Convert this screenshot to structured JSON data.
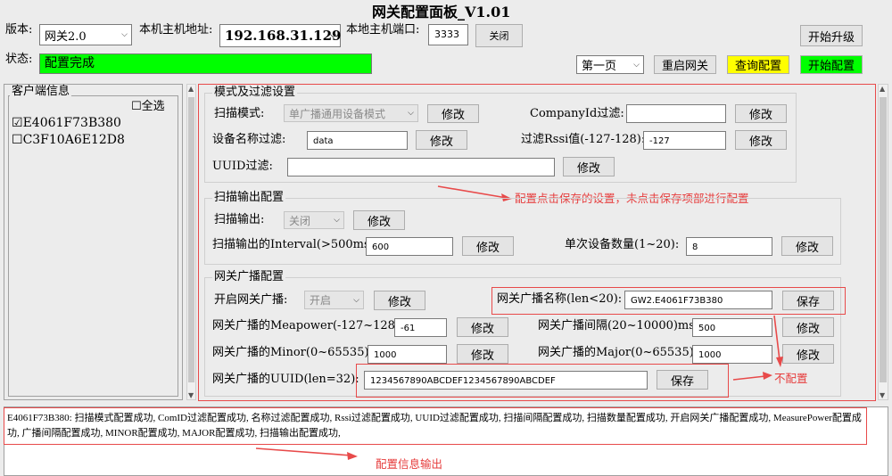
{
  "title": "网关配置面板_V1.01",
  "version": {
    "label": "版本:",
    "value": "网关2.0"
  },
  "host": {
    "label": "本机主机地址:",
    "value": "192.168.31.129"
  },
  "port": {
    "label": "本地主机端口:",
    "value": "3333",
    "close_label": "关闭"
  },
  "upgrade_label": "开始升级",
  "status": {
    "label": "状态:",
    "value": "配置完成",
    "color": "#00ff00"
  },
  "page_select": "第一页",
  "restart_label": "重启网关",
  "query_label": "查询配置",
  "start_label": "开始配置",
  "client": {
    "title": "客户端信息",
    "select_all": "全选",
    "items": [
      "E4061F73B380",
      "C3F10A6E12D8"
    ],
    "checked": [
      true,
      false
    ]
  },
  "mode": {
    "title": "模式及过滤设置",
    "scan_mode_label": "扫描模式:",
    "scan_mode_value": "单广播通用设备模式",
    "company_label": "CompanyId过滤:",
    "company_value": "",
    "name_label": "设备名称过滤:",
    "name_value": "data",
    "rssi_label": "过滤Rssi值(-127-128):",
    "rssi_value": "-127",
    "uuid_label": "UUID过滤:",
    "uuid_value": ""
  },
  "scan_out": {
    "title": "扫描输出配置",
    "output_label": "扫描输出:",
    "output_value": "关闭",
    "interval_label": "扫描输出的Interval(>500ms):",
    "interval_value": "600",
    "count_label": "单次设备数量(1~20):",
    "count_value": "8"
  },
  "gw": {
    "title": "网关广播配置",
    "enable_label": "开启网关广播:",
    "enable_value": "开启",
    "name_label": "网关广播名称(len<20):",
    "name_value": "GW2.E4061F73B380",
    "power_label": "网关广播的Meapower(-127~128):",
    "power_value": "-61",
    "interval_label": "网关广播间隔(20~10000)ms:",
    "interval_value": "500",
    "minor_label": "网关广播的Minor(0~65535):",
    "minor_value": "1000",
    "major_label": "网关广播的Major(0~65535):",
    "major_value": "1000",
    "uuid_label": "网关广播的UUID(len=32):",
    "uuid_value": "1234567890ABCDEF1234567890ABCDEF"
  },
  "modify_label": "修改",
  "save_label": "保存",
  "annotations": {
    "a1": "配置点击保存的设置，未点击保存项部进行配置",
    "a2": "不配置",
    "a3": "配置信息输出"
  },
  "log": "E4061F73B380: 扫描模式配置成功, ComID过滤配置成功, 名称过滤配置成功, Rssi过滤配置成功, UUID过滤配置成功, 扫描间隔配置成功, 扫描数量配置成功, 开启网关广播配置成功, MeasurePower配置成功, 广播间隔配置成功, MINOR配置成功, MAJOR配置成功, 扫描输出配置成功,",
  "colors": {
    "yellow": "#ffff00",
    "green": "#00ff00",
    "annotation": "#e63c3c"
  }
}
